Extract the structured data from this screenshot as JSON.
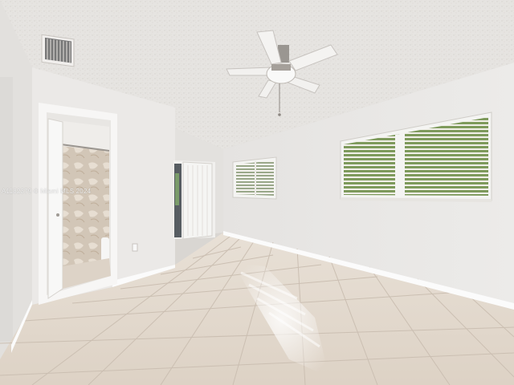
{
  "photo": {
    "watermark_text": "A1182379 © Miami MLS 2024",
    "colors": {
      "wall": "#e9e7e5",
      "ceiling": "#e4e2df",
      "floor_tile": "#e2d8cd",
      "grout": "#c9bdb1",
      "baseboard": "#fafafa",
      "window_frame": "#f4f4f2",
      "foliage": "#6b8b4a",
      "curtain": "#cfc3b4"
    },
    "objects": [
      "ceiling-fan",
      "ac-vent",
      "window-right",
      "window-left",
      "bathroom-doorway",
      "shower-curtain",
      "open-door",
      "closet-doorway",
      "tile-floor",
      "sunlight-patch"
    ]
  }
}
